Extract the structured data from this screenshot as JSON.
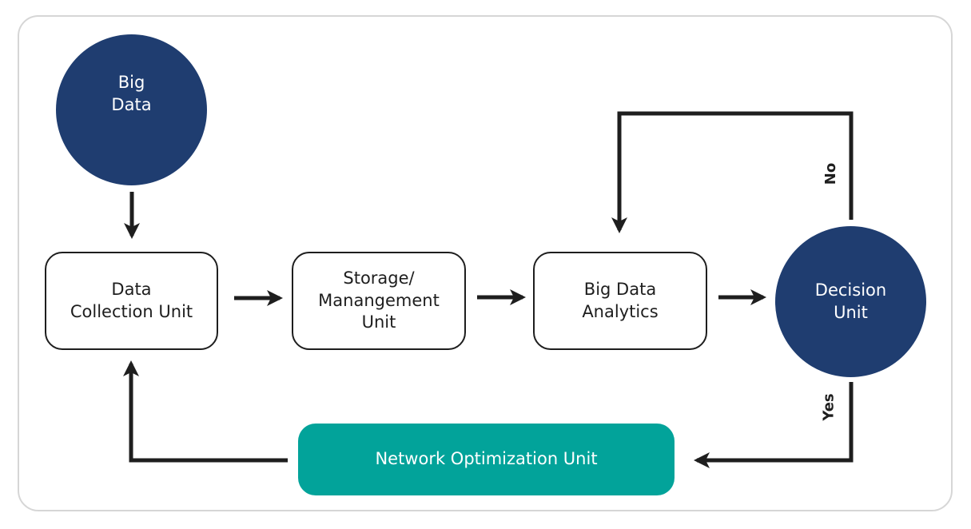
{
  "diagram": {
    "nodes": {
      "big_data": {
        "lines": [
          "Big",
          "Data"
        ],
        "shape": "circle"
      },
      "data_collection": {
        "lines": [
          "Data",
          "Collection Unit"
        ],
        "shape": "rounded-rect"
      },
      "storage": {
        "lines": [
          "Storage/",
          "Manangement",
          "Unit"
        ],
        "shape": "rounded-rect"
      },
      "analytics": {
        "lines": [
          "Big Data",
          "Analytics"
        ],
        "shape": "rounded-rect"
      },
      "decision": {
        "lines": [
          "Decision",
          "Unit"
        ],
        "shape": "circle"
      },
      "network": {
        "lines": [
          "Network Optimization Unit"
        ],
        "shape": "rounded-rect-filled"
      }
    },
    "edge_labels": {
      "no": "No",
      "yes": "Yes"
    },
    "edges": [
      {
        "from": "big_data",
        "to": "data_collection"
      },
      {
        "from": "data_collection",
        "to": "storage"
      },
      {
        "from": "storage",
        "to": "analytics"
      },
      {
        "from": "analytics",
        "to": "decision"
      },
      {
        "from": "decision",
        "to": "analytics",
        "label": "No"
      },
      {
        "from": "decision",
        "to": "network",
        "label": "Yes"
      },
      {
        "from": "network",
        "to": "data_collection"
      }
    ],
    "colors": {
      "navy": "#1f3d70",
      "teal": "#02a39a",
      "stroke": "#1e1e1e",
      "frame": "#d6d6d6"
    }
  }
}
